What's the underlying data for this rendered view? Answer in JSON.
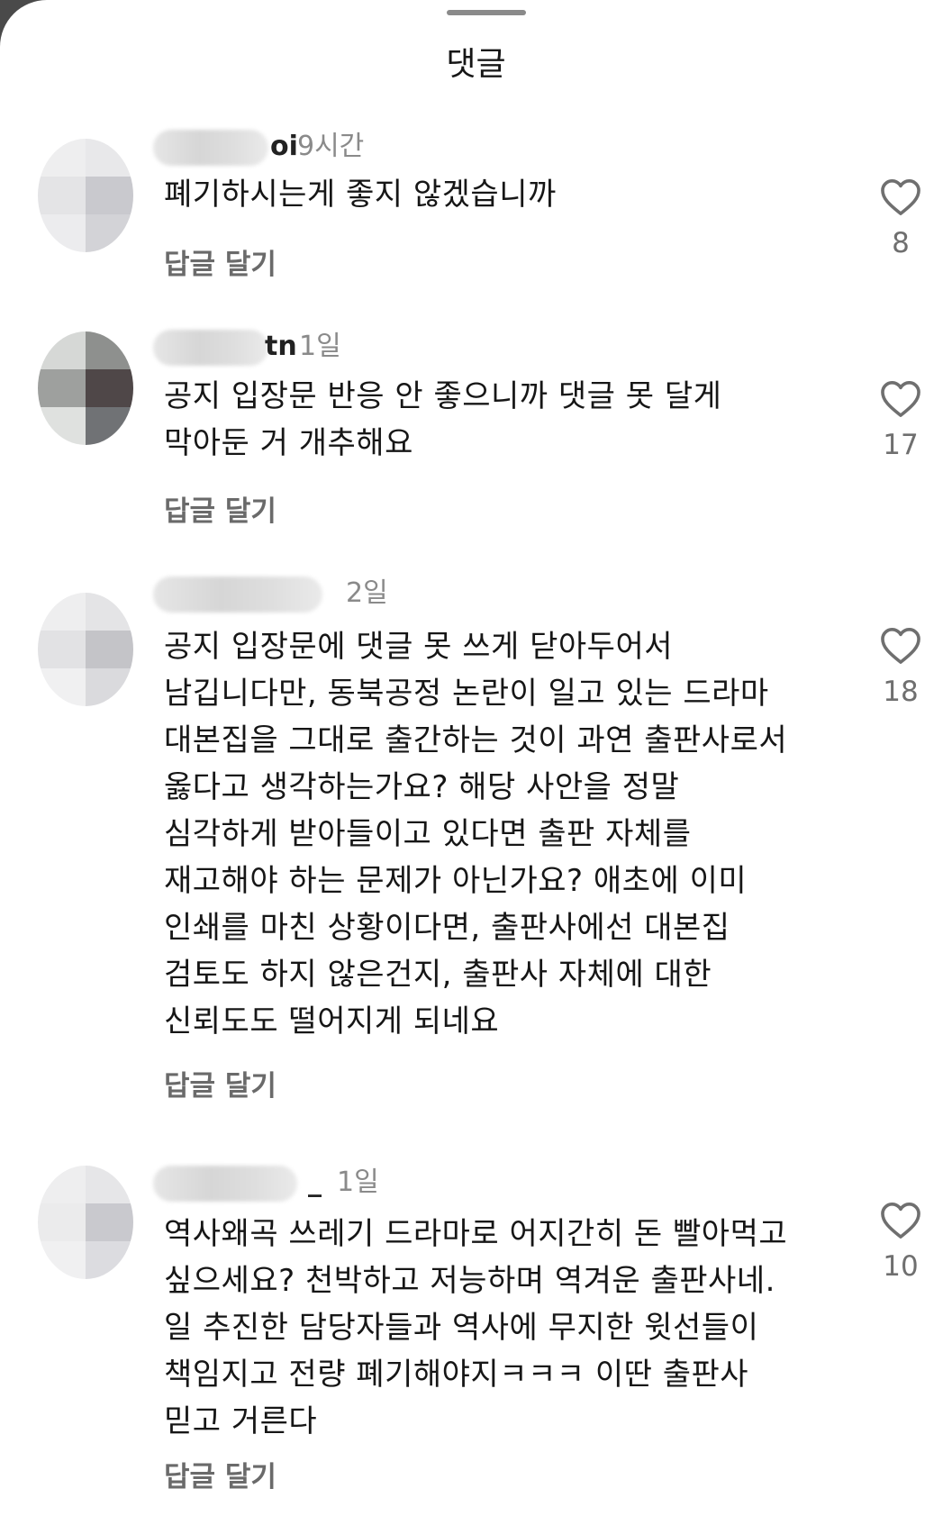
{
  "sheet": {
    "title": "댓글"
  },
  "comments": [
    {
      "user_tail": "oi",
      "time": "9시간",
      "text": "폐기하시는게 좋지 않겠습니까",
      "reply_label": "답글 달기",
      "likes": "8"
    },
    {
      "user_tail": "tn",
      "time": "1일",
      "text": "공지 입장문 반응 안 좋으니까 댓글 못 달게\n막아둔 거 개추해요",
      "reply_label": "답글 달기",
      "likes": "17"
    },
    {
      "user_tail": "",
      "time": "2일",
      "text": "공지 입장문에 댓글 못 쓰게 닫아두어서\n남깁니다만, 동북공정 논란이 일고 있는 드라마\n대본집을 그대로 출간하는 것이 과연 출판사로서\n옳다고 생각하는가요? 해당 사안을 정말\n심각하게 받아들이고 있다면 출판 자체를\n재고해야 하는 문제가 아닌가요? 애초에 이미\n인쇄를 마친 상황이다면, 출판사에선 대본집\n검토도 하지 않은건지, 출판사 자체에 대한\n신뢰도도 떨어지게 되네요",
      "reply_label": "답글 달기",
      "likes": "18"
    },
    {
      "user_tail": "_",
      "time": "1일",
      "text": "역사왜곡 쓰레기 드라마로 어지간히 돈 빨아먹고\n싶으세요? 천박하고 저능하며 역겨운 출판사네.\n일 추진한 담당자들과 역사에 무지한 윗선들이\n책임지고 전량 폐기해야지ㅋㅋㅋ 이딴 출판사\n믿고 거른다",
      "reply_label": "답글 달기",
      "likes": "10"
    }
  ],
  "icons": {
    "like": "heart-outline-icon"
  },
  "colors": {
    "text": "#161616",
    "secondary": "#8a8a8a",
    "reply": "#6a6a6a"
  }
}
